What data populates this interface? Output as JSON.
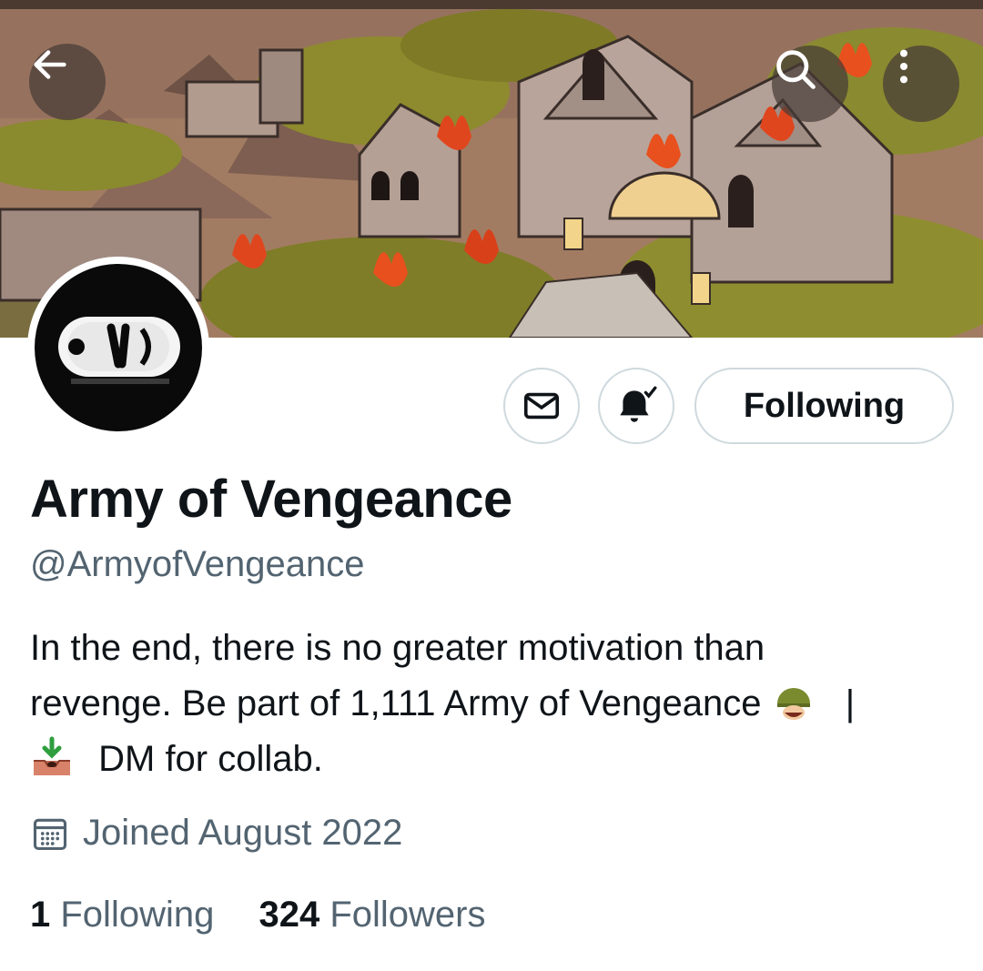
{
  "header": {
    "back_icon": "arrow-left-icon",
    "search_icon": "search-icon",
    "more_icon": "more-vertical-icon"
  },
  "profile": {
    "display_name": "Army of Vengeance",
    "handle": "@ArmyofVengeance",
    "bio": {
      "line1": "In the end, there is no greater motivation than",
      "line2_text": "revenge. Be part of 1,111 Army of Vengeance",
      "line2_sep": "|",
      "line3_text": "DM for collab.",
      "emoji_1": "military-helmet-emoji",
      "emoji_2": "inbox-tray-emoji"
    },
    "joined": "Joined August 2022",
    "following_count": "1",
    "following_label": "Following",
    "followers_count": "324",
    "followers_label": "Followers"
  },
  "actions": {
    "message_icon": "envelope-icon",
    "notifications_icon": "bell-check-icon",
    "follow_state_label": "Following"
  },
  "colors": {
    "primary_text": "#0f1419",
    "secondary_text": "#536471",
    "button_border": "#cfd9de",
    "background": "#ffffff"
  }
}
